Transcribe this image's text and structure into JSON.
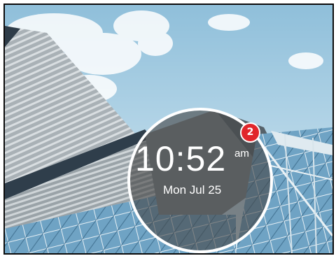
{
  "lockscreen": {
    "time": "10:52",
    "ampm": "am",
    "date": "Mon Jul 25",
    "notification_count": "2"
  },
  "colors": {
    "badge": "#e1262b",
    "dial_overlay": "#464646",
    "frame_border": "#0b0b0b",
    "sky": "#a8cde2"
  },
  "wallpaper": {
    "subject": "glass-office-towers-against-sky"
  }
}
